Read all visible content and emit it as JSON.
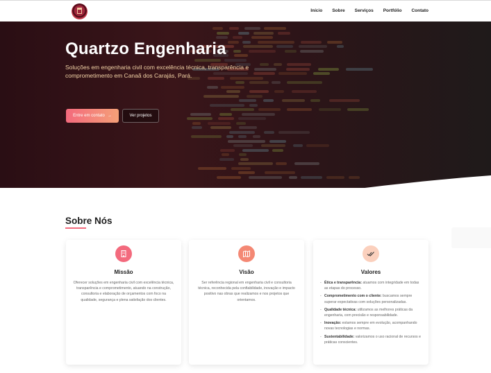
{
  "nav": {
    "links": [
      "Início",
      "Sobre",
      "Serviços",
      "Portfólio",
      "Contato"
    ],
    "logo_icon": "building-logo-icon"
  },
  "hero": {
    "title": "Quartzo Engenharia",
    "subtitle": "Soluções em engenharia civil com excelência técnica, transparência e comprometimento em Canaã dos Carajás, Pará.",
    "primary_button": "Entre em contato",
    "primary_button_icon": "arrow-right-icon",
    "secondary_button": "Ver projetos"
  },
  "about": {
    "title": "Sobre Nós",
    "cards": [
      {
        "icon": "building-icon",
        "title": "Missão",
        "text": "Oferecer soluções em engenharia civil com excelência técnica, transparência e comprometimento, atuando na construção, consultoria e elaboração de orçamentos com foco na qualidade, segurança e plena satisfação dos clientes."
      },
      {
        "icon": "map-icon",
        "title": "Visão",
        "text": "Ser referência regional em engenharia civil e consultoria técnica, reconhecida pela confiabilidade, inovação e impacto positivo nas obras que realizamos e nos projetos que orientamos."
      },
      {
        "icon": "double-check-icon",
        "title": "Valores",
        "items": [
          {
            "label": "Ética e transparência:",
            "text": " atuamos com integridade em todas as etapas do processo."
          },
          {
            "label": "Comprometimento com o cliente:",
            "text": " buscamos sempre superar expectativas com soluções personalizadas."
          },
          {
            "label": "Qualidade técnica:",
            "text": " utilizamos as melhores práticas da engenharia, com precisão e responsabilidade."
          },
          {
            "label": "Inovação:",
            "text": " estamos sempre em evolução, acompanhando novas tecnologias e normas."
          },
          {
            "label": "Sustentabilidade:",
            "text": " valorizamos o uso racional de recursos e práticas conscientes."
          }
        ]
      }
    ]
  },
  "colors": {
    "accent": "#f36a7d",
    "accent_2": "#f5a078",
    "hero_text": "#f3d3a6"
  }
}
